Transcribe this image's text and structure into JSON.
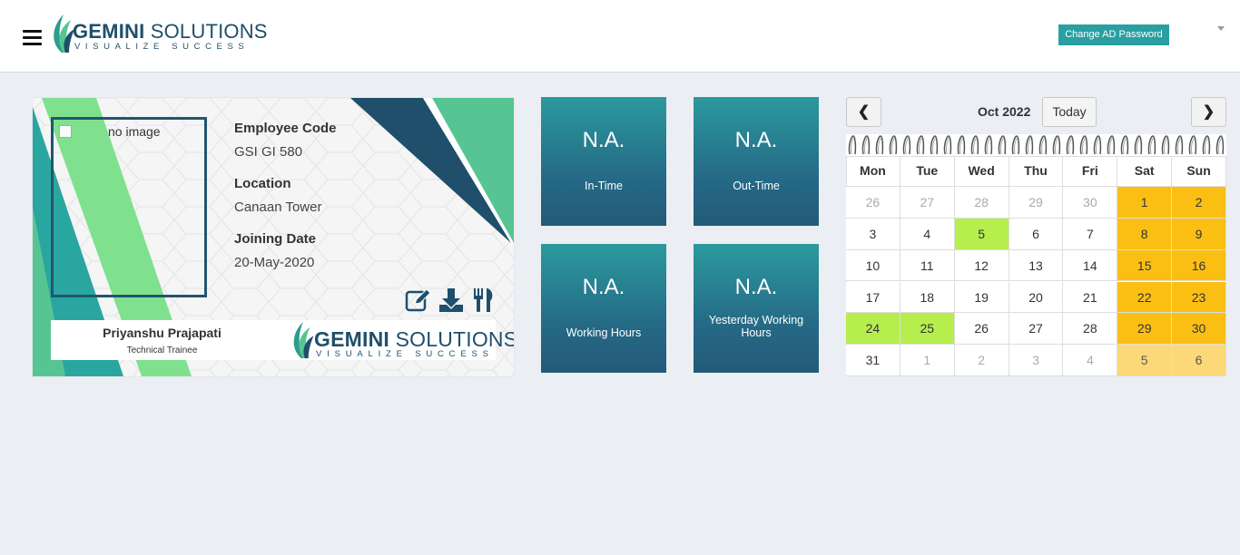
{
  "header": {
    "logo": {
      "brand_bold": "GEMINI",
      "brand_rest": " SOLUTIONS",
      "tagline": "VISUALIZE SUCCESS"
    },
    "change_password_label": "Change AD Password"
  },
  "employee_card": {
    "photo_alt": "no image",
    "fields": [
      {
        "label": "Employee Code",
        "value": "GSI GI 580"
      },
      {
        "label": "Location",
        "value": "Canaan Tower"
      },
      {
        "label": "Joining Date",
        "value": "20-May-2020"
      }
    ],
    "name": "Priyanshu Prajapati",
    "role": "Technical Trainee",
    "logo": {
      "brand_bold": "GEMINI",
      "brand_rest": " SOLUTIONS",
      "tagline": "VISUALIZE SUCCESS"
    }
  },
  "tiles": [
    {
      "value": "N.A.",
      "label": "In-Time"
    },
    {
      "value": "N.A.",
      "label": "Out-Time"
    },
    {
      "value": "N.A.",
      "label": "Working Hours"
    },
    {
      "value": "N.A.",
      "label": "Yesterday Working Hours"
    }
  ],
  "calendar": {
    "month_label": "Oct 2022",
    "today_label": "Today",
    "prev_label": "❮",
    "next_label": "❯",
    "weekdays": [
      "Mon",
      "Tue",
      "Wed",
      "Thu",
      "Fri",
      "Sat",
      "Sun"
    ],
    "weeks": [
      [
        "26",
        "27",
        "28",
        "29",
        "30",
        "1",
        "2"
      ],
      [
        "3",
        "4",
        "5",
        "6",
        "7",
        "8",
        "9"
      ],
      [
        "10",
        "11",
        "12",
        "13",
        "14",
        "15",
        "16"
      ],
      [
        "17",
        "18",
        "19",
        "20",
        "21",
        "22",
        "23"
      ],
      [
        "24",
        "25",
        "26",
        "27",
        "28",
        "29",
        "30"
      ],
      [
        "31",
        "1",
        "2",
        "3",
        "4",
        "5",
        "6"
      ]
    ],
    "other_month_mask": [
      [
        1,
        1,
        1,
        1,
        1,
        0,
        0
      ],
      [
        0,
        0,
        0,
        0,
        0,
        0,
        0
      ],
      [
        0,
        0,
        0,
        0,
        0,
        0,
        0
      ],
      [
        0,
        0,
        0,
        0,
        0,
        0,
        0
      ],
      [
        0,
        0,
        0,
        0,
        0,
        0,
        0
      ],
      [
        0,
        1,
        1,
        1,
        1,
        1,
        1
      ]
    ],
    "highlights": {
      "green": [
        "5",
        "24",
        "25"
      ]
    },
    "colors": {
      "weekend": "#fbbf14",
      "weekend_other": "#fcd978",
      "present": "#b6ee4e",
      "other_month_text": "#aaaaaa"
    }
  },
  "colors": {
    "teal": "#2a9ea1",
    "navy": "#1f4f6b",
    "green": "#56c593",
    "light_green": "#7fe18e"
  }
}
